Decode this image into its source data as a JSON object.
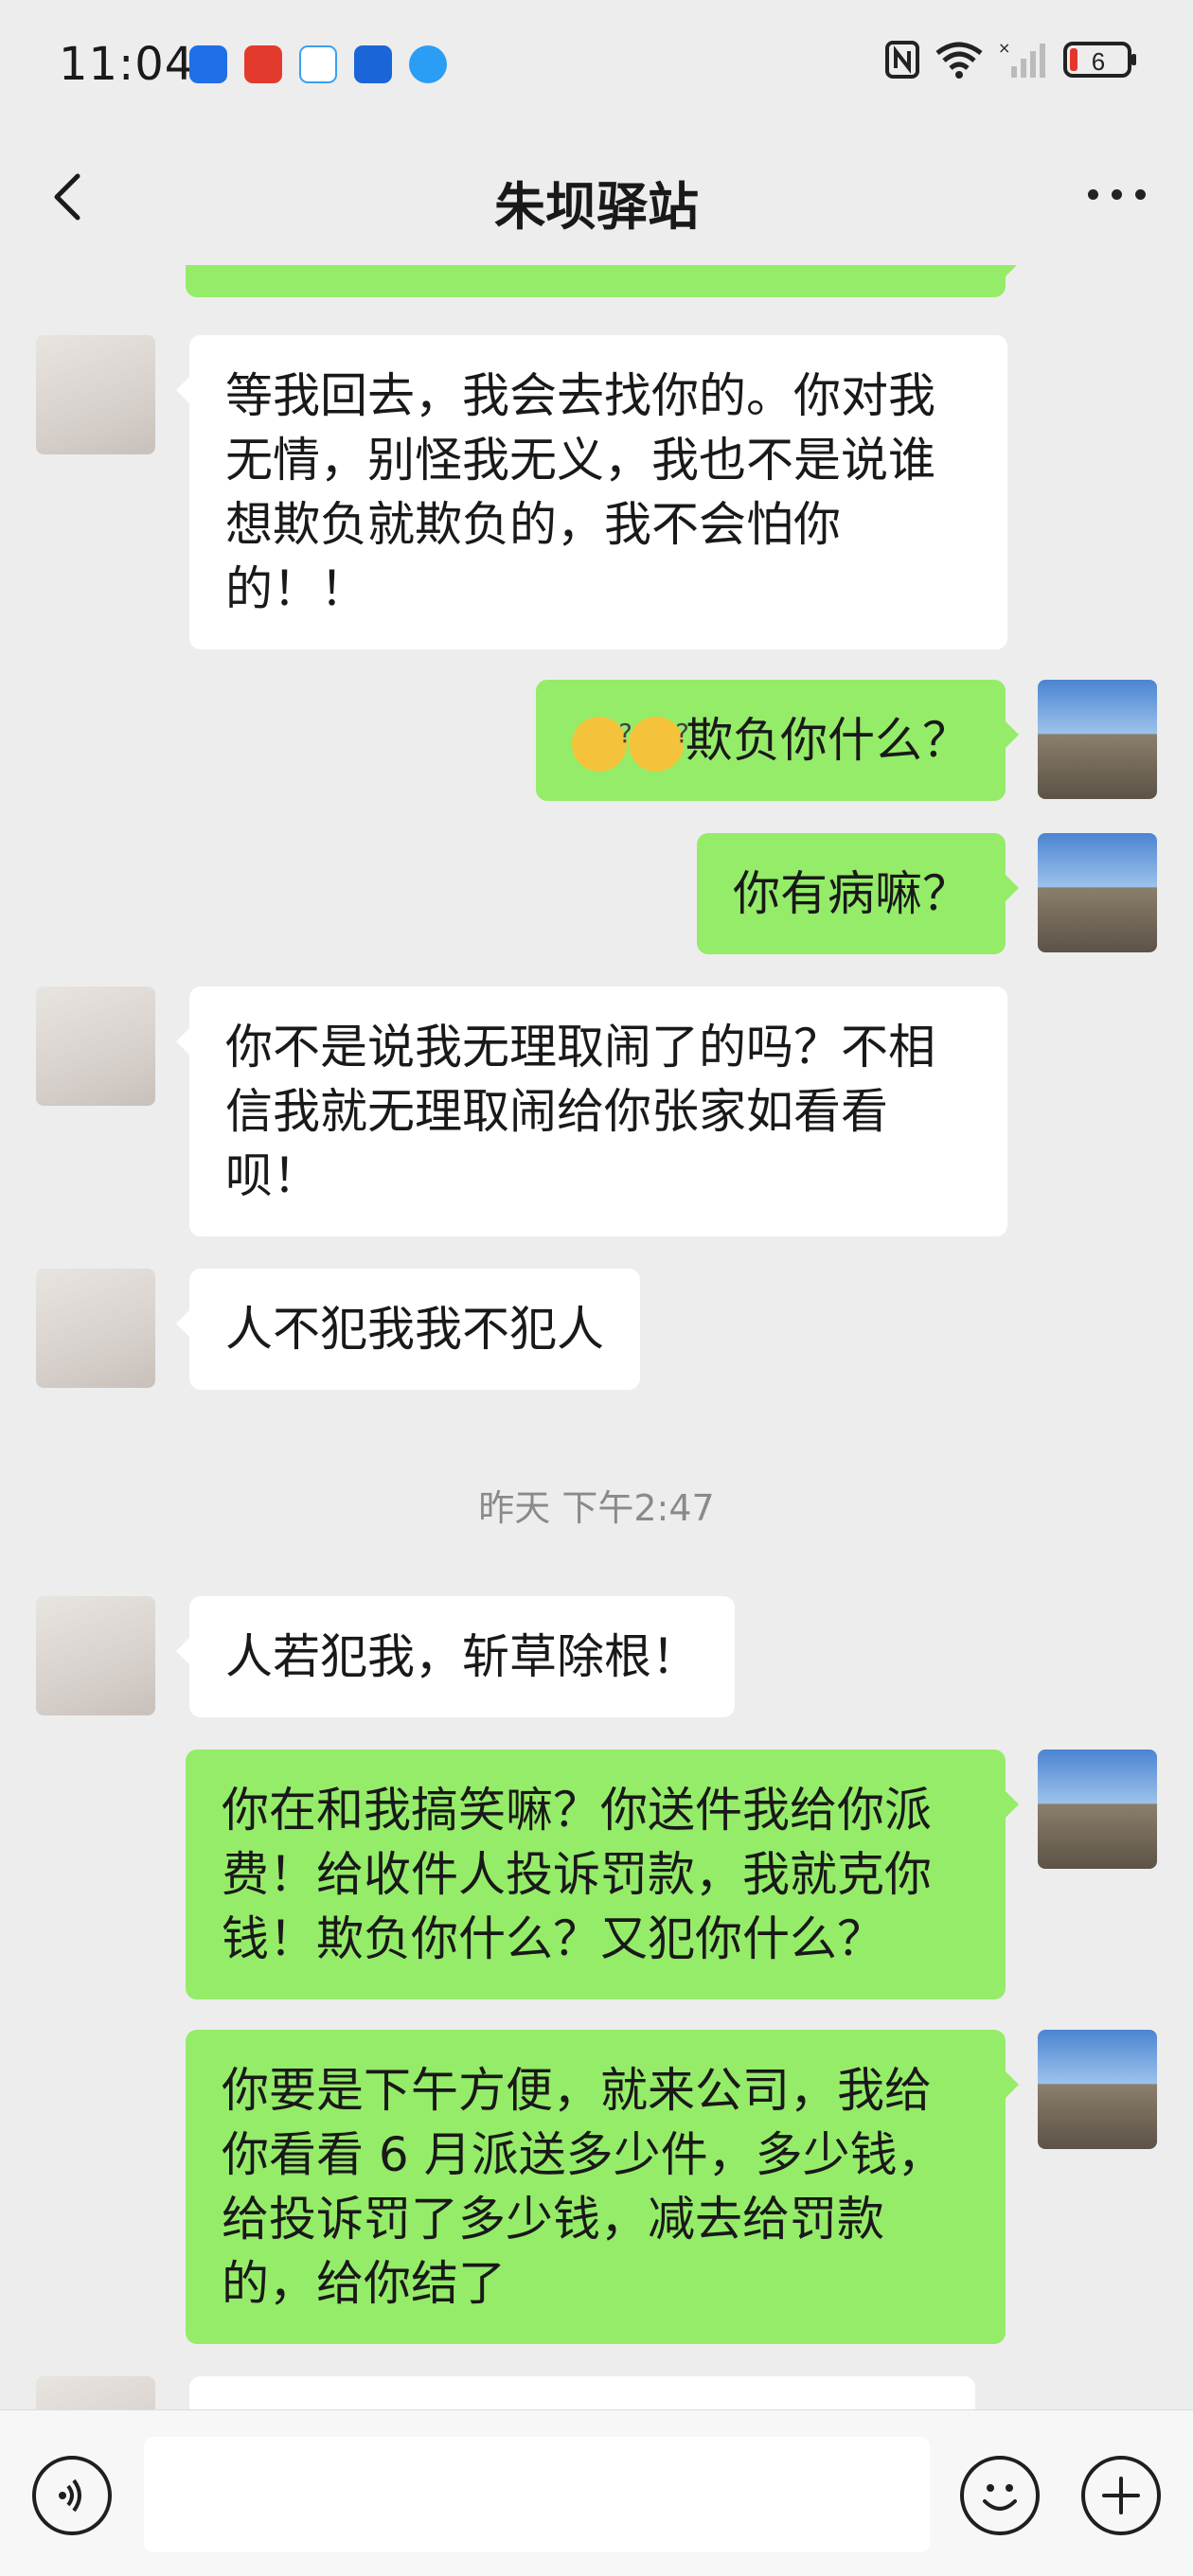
{
  "status": {
    "time": "11:04",
    "battery": "6"
  },
  "header": {
    "title": "朱坝驿站"
  },
  "messages": {
    "m1": "等我回去，我会去找你的。你对我无情，别怪我无义，我也不是说谁想欺负就欺负的，我不会怕你的！！",
    "m2": "欺负你什么？",
    "m3": "你有病嘛？",
    "m4": "你不是说我无理取闹了的吗？不相信我就无理取闹给你张家如看看呗！",
    "m5": "人不犯我我不犯人",
    "timestamp": "昨天 下午2:47",
    "m6": "人若犯我，斩草除根！",
    "m7": "你在和我搞笑嘛？你送件我给你派费！给收件人投诉罚款，我就克你钱！欺负你什么？又犯你什么？",
    "m8": "你要是下午方便，就来公司，我给你看看 6 月派送多少件，多少钱，给投诉罚了多少钱，减去给罚款的，给你结了"
  },
  "icons": {
    "back": "chevron-left-icon",
    "more": "more-dots-icon",
    "voice": "voice-icon",
    "emoji": "emoji-icon",
    "plus": "plus-icon"
  },
  "colors": {
    "sent_bubble": "#95ec69",
    "received_bubble": "#ffffff",
    "background": "#ededed"
  }
}
